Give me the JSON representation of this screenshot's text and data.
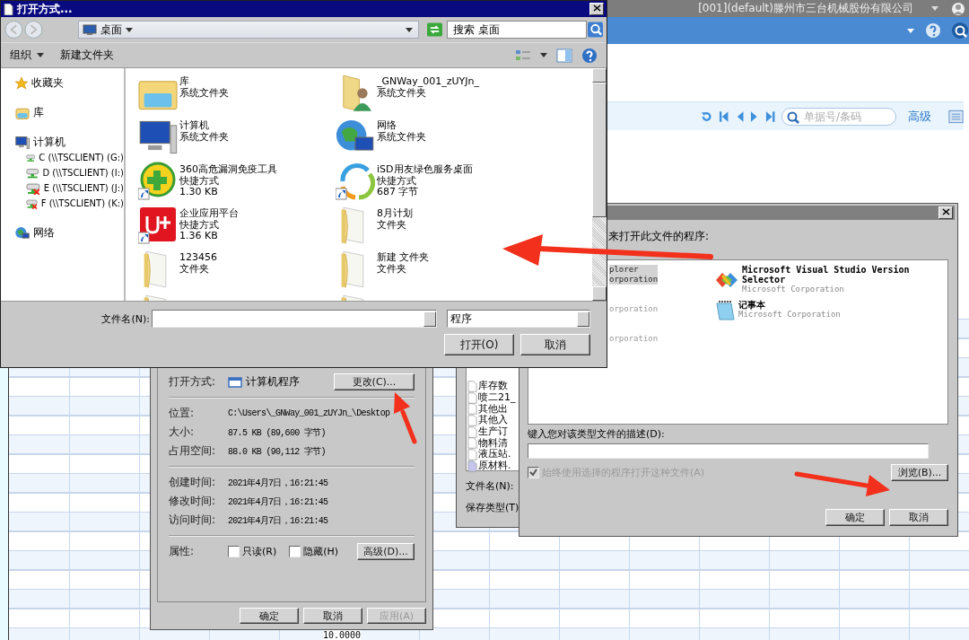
{
  "app": {
    "company": "[001](default)滕州市三台机械股份有限公司",
    "search": {
      "placeholder": "单据号/条码"
    },
    "advanced": "高级",
    "grid_cell": "10.0000"
  },
  "properties_dialog": {
    "open_with_label": "打开方式:",
    "program": "计算机程序",
    "change_button": "更改(C)...",
    "detail_groups": [
      [
        {
          "label": "位置:",
          "value": "C:\\Users\\_GNWay_001_zUYJn_\\Desktop"
        },
        {
          "label": "大小:",
          "value": "87.5 KB (89,600 字节)"
        },
        {
          "label": "占用空间:",
          "value": "88.0 KB (90,112 字节)"
        }
      ],
      [
        {
          "label": "创建时间:",
          "value": "2021年4月7日，16:21:45"
        },
        {
          "label": "修改时间:",
          "value": "2021年4月7日，16:21:45"
        },
        {
          "label": "访问时间:",
          "value": "2021年4月7日，16:21:45"
        }
      ]
    ],
    "attributes_label": "属性:",
    "attributes": [
      {
        "label": "只读(R)",
        "checked": false
      },
      {
        "label": "隐藏(H)",
        "checked": false
      }
    ],
    "advanced_button": "高级(D)...",
    "buttons": [
      {
        "label": "确定",
        "disabled": false
      },
      {
        "label": "取消",
        "disabled": false
      },
      {
        "label": "应用(A)",
        "disabled": true
      }
    ]
  },
  "save_dialog": {
    "files": [
      {
        "name": "库存数",
        "kind": "blank"
      },
      {
        "name": "喷二21_",
        "kind": "blank"
      },
      {
        "name": "其他出",
        "kind": "blank"
      },
      {
        "name": "其他入",
        "kind": "blank"
      },
      {
        "name": "生产订",
        "kind": "blank"
      },
      {
        "name": "物料清",
        "kind": "blank"
      },
      {
        "name": "液压站.",
        "kind": "blank"
      },
      {
        "name": "原材料.",
        "kind": "sheet"
      }
    ],
    "file_name_label": "文件名(N):",
    "file_type_label": "保存类型(T)"
  },
  "open_with_dialog": {
    "prompt": "来打开此文件的程序:",
    "hidden_programs": [
      {
        "name": "plorer",
        "publisher": "orporation",
        "selected": true
      },
      {
        "publisher": "orporation",
        "selected": false
      },
      {
        "publisher": "orporation",
        "selected": false
      }
    ],
    "programs": [
      {
        "name": "Microsoft Visual Studio Version Selector",
        "publisher": "Microsoft Corporation",
        "kind": "visual-studio"
      },
      {
        "name": "记事本",
        "publisher": "Microsoft Corporation",
        "kind": "notepad"
      }
    ],
    "description_label": "键入您对该类型文件的描述(D):",
    "always_use": {
      "label": "始终使用选择的程序打开这种文件(A)",
      "checked": true,
      "disabled": true
    },
    "browse_button": "浏览(B)...",
    "buttons": [
      "确定",
      "取消"
    ]
  },
  "open_dialog": {
    "title": "打开方式...",
    "location": "桌面",
    "search": {
      "placeholder": "搜索 桌面"
    },
    "toolbar": [
      {
        "label": "组织",
        "kind": "menu"
      },
      {
        "label": "新建文件夹",
        "kind": "command"
      }
    ],
    "nav": [
      {
        "label": "收藏夹",
        "kind": "star"
      },
      {
        "label": "库",
        "kind": "library"
      },
      {
        "label": "计算机",
        "kind": "computer",
        "children": [
          {
            "label": "C (\\\\TSCLIENT) (G:)",
            "kind": "drive",
            "disconnected": false
          },
          {
            "label": "D (\\\\TSCLIENT) (I:)",
            "kind": "drive",
            "disconnected": false
          },
          {
            "label": "E (\\\\TSCLIENT) (J:)",
            "kind": "drive",
            "disconnected": true
          },
          {
            "label": "F (\\\\TSCLIENT) (K:)",
            "kind": "drive",
            "disconnected": true
          }
        ]
      },
      {
        "label": "网络",
        "kind": "network"
      }
    ],
    "items": [
      {
        "name": "库",
        "type": "系统文件夹",
        "kind": "library"
      },
      {
        "name": "_GNWay_001_zUYJn_",
        "type": "系统文件夹",
        "kind": "user"
      },
      {
        "name": "计算机",
        "type": "系统文件夹",
        "kind": "computer"
      },
      {
        "name": "网络",
        "type": "系统文件夹",
        "kind": "network"
      },
      {
        "name": "360高危漏洞免疫工具",
        "type": "快捷方式",
        "size": "1.30 KB",
        "kind": "shield-app"
      },
      {
        "name": "iSD用友绿色服务桌面",
        "type": "快捷方式",
        "size": "687 字节",
        "kind": "swirl-app"
      },
      {
        "name": "企业应用平台",
        "type": "快捷方式",
        "size": "1.36 KB",
        "kind": "red-app"
      },
      {
        "name": "8月计划",
        "type": "文件夹",
        "kind": "folder"
      },
      {
        "name": "123456",
        "type": "文件夹",
        "kind": "folder"
      },
      {
        "name": "新建 文件夹",
        "type": "文件夹",
        "kind": "folder"
      },
      {
        "kind": "folder"
      },
      {
        "kind": "folder"
      }
    ],
    "file_name_label": "文件名(N):",
    "file_type": "程序",
    "buttons": [
      "打开(O)",
      "取消"
    ]
  }
}
